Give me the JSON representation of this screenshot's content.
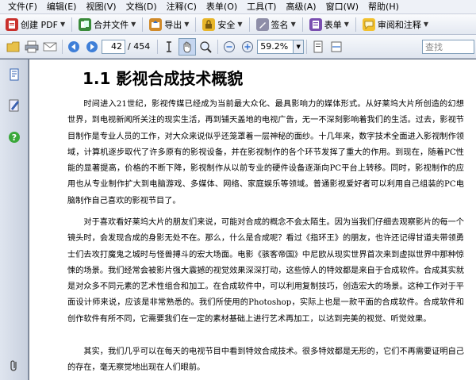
{
  "menu": [
    "文件(F)",
    "编辑(E)",
    "视图(V)",
    "文档(D)",
    "注释(C)",
    "表单(O)",
    "工具(T)",
    "高级(A)",
    "窗口(W)",
    "帮助(H)"
  ],
  "task_toolbar": {
    "create_pdf": "创建 PDF",
    "combine": "合并文件",
    "export": "导出",
    "security": "安全",
    "sign": "签名",
    "forms": "表单",
    "review": "审阅和注释"
  },
  "nav": {
    "page_current": "42",
    "page_total": "/ 454",
    "zoom": "59.2%",
    "search_placeholder": "查找"
  },
  "document": {
    "title": "1.1  影视合成技术概貌",
    "paragraphs": [
      "时间进入21世纪，影视传媒已经成为当前最大众化、最具影响力的媒体形式。从好莱坞大片所创造的幻想世界，到电视新闻所关注的现实生活，再到铺天盖地的电视广告，无一不深刻影响着我们的生活。过去，影视节目制作是专业人员的工作，对大众来说似乎还笼罩着一层神秘的面纱。十几年来，数字技术全面进入影视制作领域，计算机逐步取代了许多原有的影视设备，并在影视制作的各个环节发挥了重大的作用。到现在，随着PC性能的显著提高，价格的不断下降，影视制作从以前专业的硬件设备逐渐向PC平台上转移。同时，影视制作的应用也从专业制作扩大到电脑游戏、多媒体、网络、家庭娱乐等领域。普通影视爱好者可以利用自己组装的PC电脑制作自己喜欢的影视节目了。",
      "对于喜欢看好莱坞大片的朋友们来说，可能对合成的概念不会太陌生。因为当我们仔细去观察影片的每一个镜头时，会发现合成的身影无处不在。那么，什么是合成呢？看过《指环王》的朋友，也许还记得甘道夫带领勇士们去攻打魔鬼之城时与怪兽搏斗的宏大场面。电影《骇客帝国》中尼欧从现实世界首次来到虚拟世界中那种惊悚的场景。我们经常会被影片强大震撼的视觉效果深深打动，这些惊人的特效都是来自于合成软件。合成其实就是对众多不同元素的艺术性组合和加工。在合成软件中，可以利用复制技巧，创造宏大的场景。这种工作对于平面设计师来说，应该是非常熟悉的。我们所使用的Photoshop，实际上也是一款平面的合成软件。合成软件和创作软件有所不同，它需要我们在一定的素材基础上进行艺术再加工，以达到完美的视觉、听觉效果。",
      "其实，我们几乎可以在每天的电视节目中看到特效合成技术。很多特效都是无形的，它们不再需要证明自己的存在，毫无察觉地出现在人们眼前。"
    ]
  },
  "colors": {
    "menubar_bg": "#eef1f7",
    "toolbar_bg": "#e3e8f1",
    "panel_bg": "#c8d0de",
    "accent_blue": "#2f6fd0"
  }
}
